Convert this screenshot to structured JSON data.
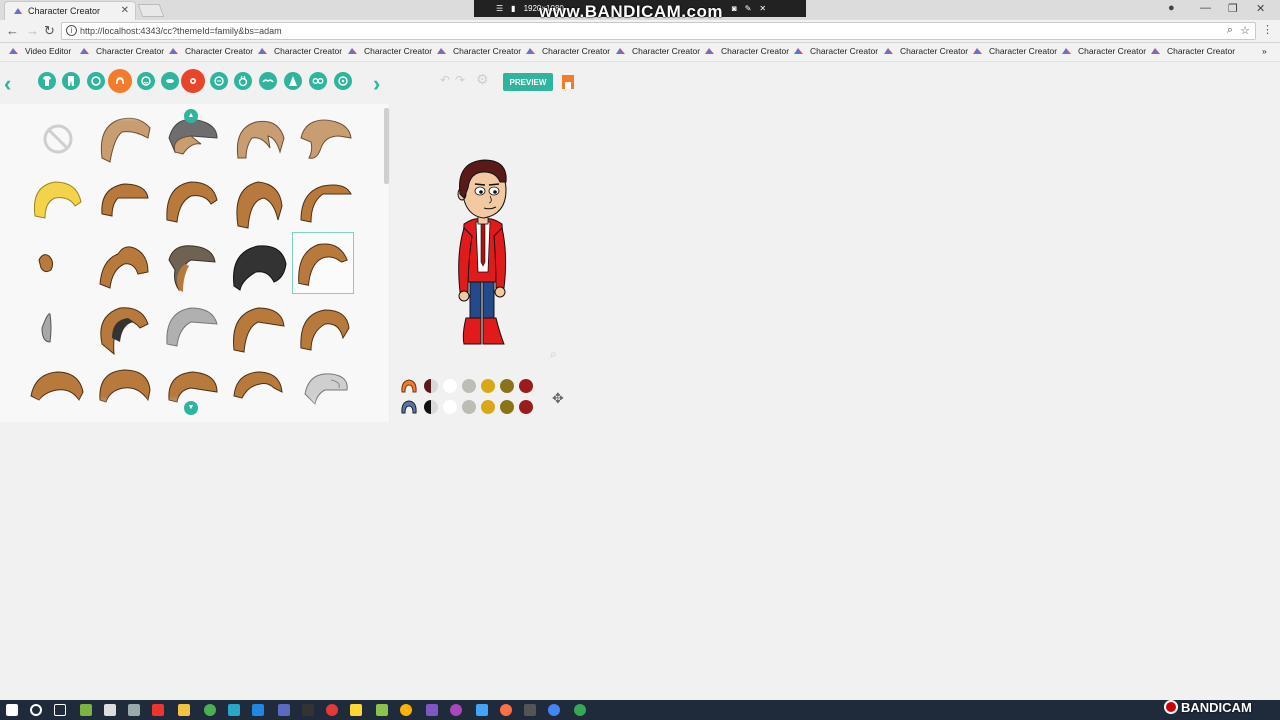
{
  "browser": {
    "tab_title": "Character Creator",
    "url": "http://localhost:4343/cc?themeId=family&bs=adam",
    "bookmarks": [
      "Video Editor",
      "Character Creator",
      "Character Creator",
      "Character Creator",
      "Character Creator",
      "Character Creator",
      "Character Creator",
      "Character Creator",
      "Character Creator",
      "Character Creator",
      "Character Creator",
      "Character Creator",
      "Character Creator",
      "Character Creator"
    ]
  },
  "recording": {
    "resolution": "1920×1080",
    "watermark": "www.BANDICAM.com",
    "brand": "BANDICAM"
  },
  "app": {
    "preview_label": "PREVIEW",
    "accent_color": "#2fb59e",
    "active_color": "#f07c2c",
    "categories": [
      "upper-body-icon",
      "lower-body-icon",
      "head-icon",
      "hair-icon",
      "face-icon",
      "mouth-icon",
      "eyes-icon",
      "nose-icon",
      "ears-icon",
      "eyebrows-icon",
      "beard-icon",
      "glasses-icon",
      "accessory-icon"
    ],
    "selected_item": "hair style row 3 column 5",
    "swatch_row_1": [
      "#5b1a1a",
      "#ffffff",
      "#bdbdb5",
      "#d9a816",
      "#8a7417",
      "#9b1c1c"
    ],
    "swatch_row_2": [
      "#111111",
      "#ffffff",
      "#bdbdb5",
      "#d9a816",
      "#8a7417",
      "#9b1c1c"
    ]
  }
}
